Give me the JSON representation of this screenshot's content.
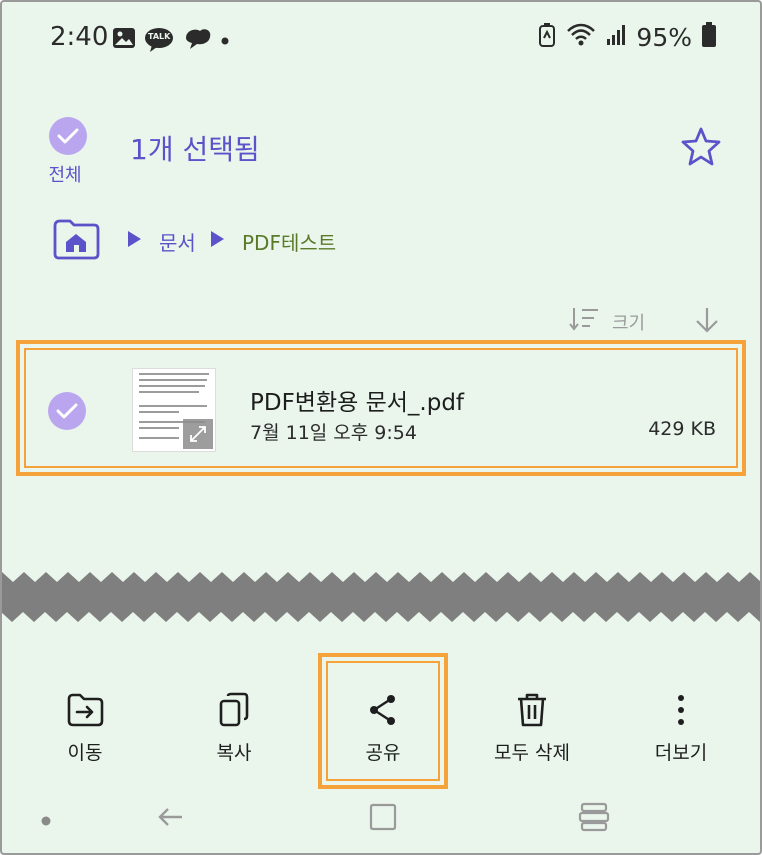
{
  "status_bar": {
    "time": "2:40",
    "notification_icons": [
      "gallery-icon",
      "kakaotalk-icon",
      "chat-bubble-icon",
      "dot-icon"
    ],
    "talk_badge": "TALK",
    "battery_percent": "95%",
    "right_icons": [
      "battery-saver-icon",
      "wifi-icon",
      "signal-icon",
      "battery-icon"
    ]
  },
  "header": {
    "select_all_label": "전체",
    "title": "1개 선택됨"
  },
  "breadcrumb": {
    "items": [
      "문서",
      "PDF테스트"
    ],
    "colors": [
      "#5b53c9",
      "#5a7a2a"
    ]
  },
  "sort": {
    "label": "크기"
  },
  "file": {
    "name": "PDF변환용 문서_.pdf",
    "date": "7월 11일 오후 9:54",
    "size": "429 KB",
    "selected": true
  },
  "toolbar": {
    "items": [
      {
        "label": "이동",
        "icon": "move-folder-icon"
      },
      {
        "label": "복사",
        "icon": "copy-icon"
      },
      {
        "label": "공유",
        "icon": "share-icon"
      },
      {
        "label": "모두 삭제",
        "icon": "trash-icon"
      },
      {
        "label": "더보기",
        "icon": "more-vert-icon"
      }
    ]
  },
  "colors": {
    "background": "#eaf6ec",
    "accent": "#5b53c9",
    "highlight": "#f6a23a",
    "check_fill": "#b9a6ee"
  }
}
